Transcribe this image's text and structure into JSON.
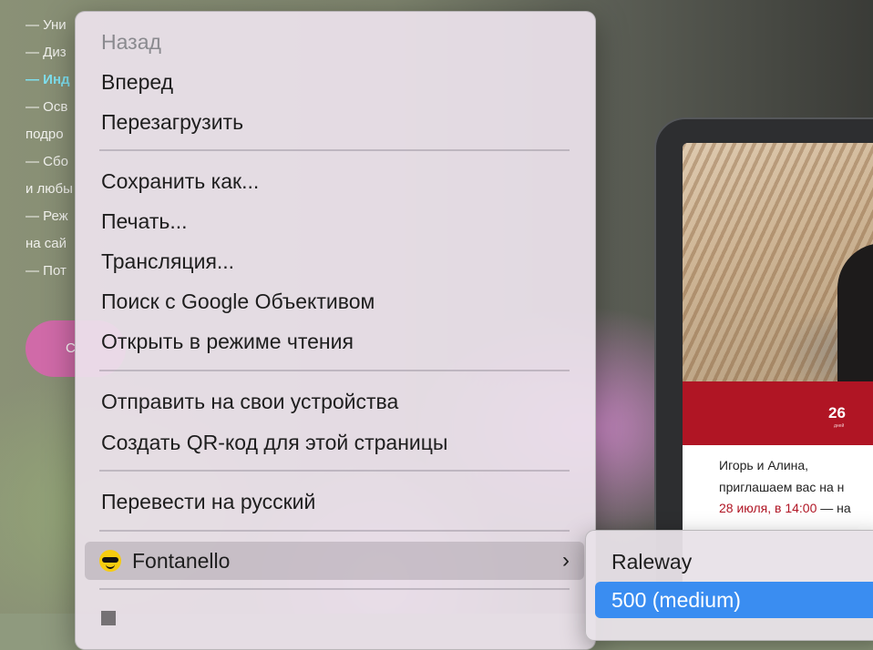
{
  "background_page": {
    "lines": [
      {
        "text": "— Уни"
      },
      {
        "text": "— Диз"
      },
      {
        "text": "— Инд"
      },
      {
        "text": "— Осв"
      },
      {
        "text": "подро"
      },
      {
        "text": "— Сбо"
      },
      {
        "text": "и любы"
      },
      {
        "text": "— Реж"
      },
      {
        "text": "на сай"
      },
      {
        "text": "— Пот"
      }
    ],
    "button_label": "С",
    "tablet": {
      "date_number": "26",
      "date_sub": "дней",
      "invite_line1": "Игорь и Алина,",
      "invite_line2": "приглашаем вас на н",
      "invite_date": "28 июля, в 14:00",
      "invite_tail": " — на"
    }
  },
  "context_menu": {
    "items": [
      {
        "label": "Назад",
        "enabled": false
      },
      {
        "label": "Вперед",
        "enabled": true
      },
      {
        "label": "Перезагрузить",
        "enabled": true
      },
      {
        "label": "Сохранить как...",
        "enabled": true
      },
      {
        "label": "Печать...",
        "enabled": true
      },
      {
        "label": "Трансляция...",
        "enabled": true
      },
      {
        "label": "Поиск с Google Объективом",
        "enabled": true
      },
      {
        "label": "Открыть в режиме чтения",
        "enabled": true
      },
      {
        "label": "Отправить на свои устройства",
        "enabled": true
      },
      {
        "label": "Создать QR-код для этой страницы",
        "enabled": true
      },
      {
        "label": "Перевести на русский",
        "enabled": true
      }
    ],
    "extension": {
      "label": "Fontanello",
      "icon": "fontanello-icon",
      "chevron": "›"
    }
  },
  "submenu": {
    "font_family": "Raleway",
    "font_weight": "500 (medium)"
  },
  "colors": {
    "menu_bg": "#ece2ec",
    "highlight": "#3a8df1",
    "accent_red": "#b01524",
    "link_cyan": "#7fe0ef"
  }
}
